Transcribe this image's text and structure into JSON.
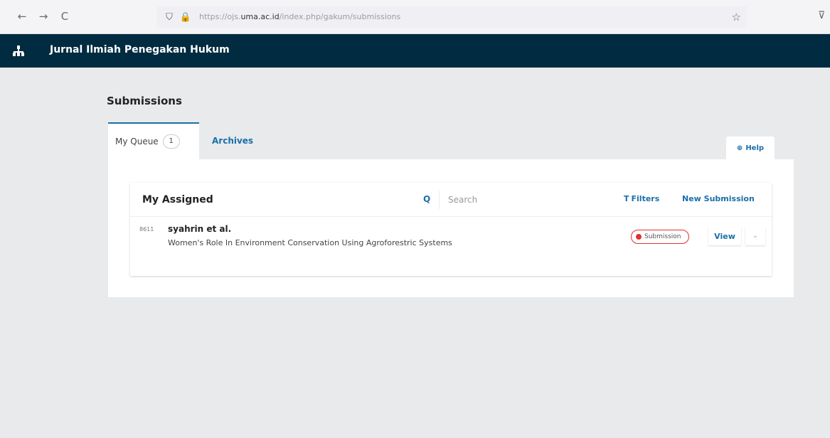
{
  "browser": {
    "back_icon": "←",
    "forward_icon": "→",
    "reload_icon": "C",
    "shield_icon": "⛉",
    "lock_icon": "🔒",
    "url_prefix": "https://ojs.",
    "url_domain": "uma.ac.id",
    "url_path": "/index.php/gakum/submissions",
    "star_icon": "☆",
    "ext_icon": "⊽"
  },
  "header": {
    "app_title": "Jurnal Ilmiah Penegakan Hukum"
  },
  "page": {
    "title": "Submissions"
  },
  "tabs": {
    "queue_label": "My Queue",
    "queue_count": "1",
    "archives_label": "Archives",
    "help_icon": "⊕",
    "help_label": "Help"
  },
  "list": {
    "title": "My Assigned",
    "search_icon": "Q",
    "search_placeholder": "Search",
    "filter_icon": "T",
    "filters_label": "Filters",
    "new_submission_label": "New Submission",
    "items": [
      {
        "id": "8611",
        "author": "syahrin et al.",
        "title": "Women's Role In Environment Conservation Using Agroforestric Systems",
        "stage": "Submission",
        "view_label": "View",
        "expand_icon": "⌄"
      }
    ]
  },
  "colors": {
    "header_bg": "#002b40",
    "accent": "#1a6fa8",
    "stage_badge": "#dd3333",
    "page_bg": "#e8eaec"
  }
}
